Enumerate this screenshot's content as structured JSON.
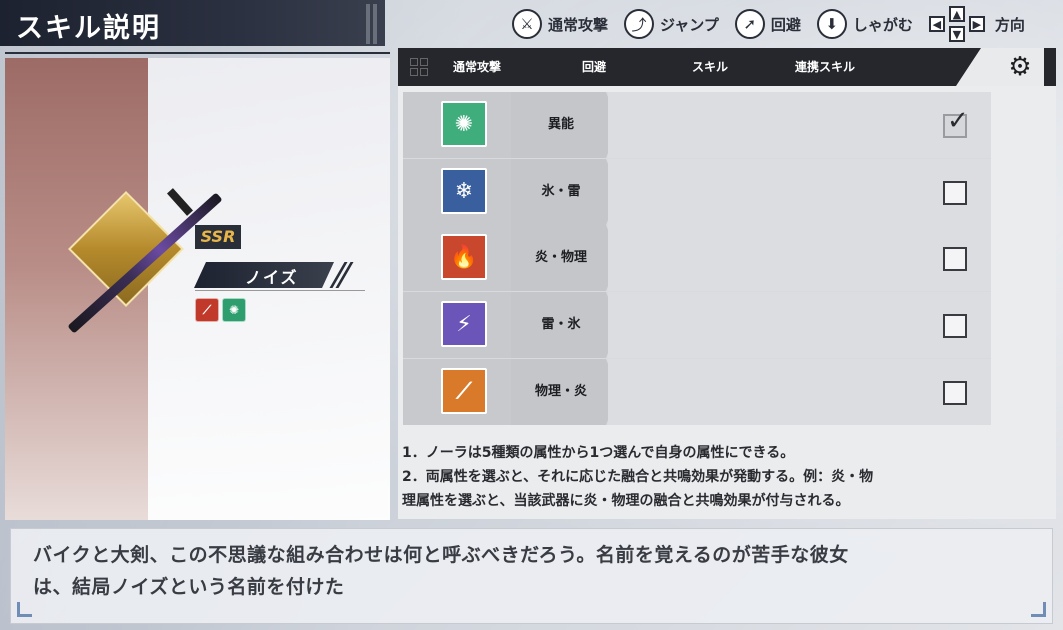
{
  "title": "スキル説明",
  "controls": [
    {
      "icon": "attack-icon",
      "label": "通常攻撃"
    },
    {
      "icon": "jump-icon",
      "label": "ジャンプ"
    },
    {
      "icon": "dodge-icon",
      "label": "回避"
    },
    {
      "icon": "crouch-icon",
      "label": "しゃがむ"
    }
  ],
  "direction_label": "方向",
  "weapon": {
    "rarity": "SSR",
    "name": "ノイズ",
    "elements": [
      "physical-fire-icon",
      "anomaly-icon"
    ]
  },
  "tabs": [
    "通常攻撃",
    "回避",
    "スキル",
    "連携スキル"
  ],
  "attribute_rows": [
    {
      "label": "異能",
      "icon": "anomaly-icon",
      "color": "#3fae7c",
      "checked": true
    },
    {
      "label": "氷・雷",
      "icon": "ice-thunder-icon",
      "color": "#3a5f9e",
      "checked": false
    },
    {
      "label": "炎・物理",
      "icon": "fire-physical-icon",
      "color": "#c9472c",
      "checked": false
    },
    {
      "label": "雷・氷",
      "icon": "thunder-ice-icon",
      "color": "#6b55b8",
      "checked": false
    },
    {
      "label": "物理・炎",
      "icon": "physical-fire-icon",
      "color": "#d97a2a",
      "checked": false
    }
  ],
  "description": [
    "1．ノーラは5種類の属性から1つ選んで自身の属性にできる。",
    "2．両属性を選ぶと、それに応じた融合と共鳴効果が発動する。例：炎・物",
    "理属性を選ぶと、当該武器に炎・物理の融合と共鳴効果が付与される。"
  ],
  "flavor_text": [
    "バイクと大剣、この不思議な組み合わせは何と呼ぶべきだろう。名前を覚えるのが苦手な彼女",
    "は、結局ノイズという名前を付けた"
  ]
}
